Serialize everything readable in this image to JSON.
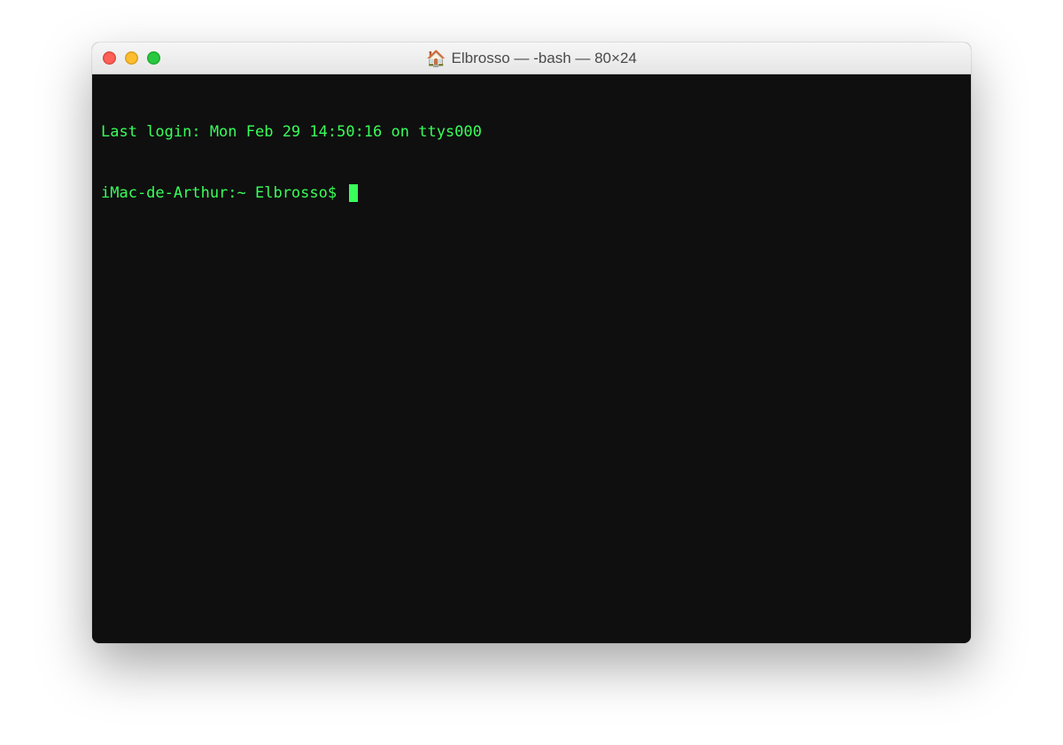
{
  "window": {
    "title_icon": "home-icon",
    "title": "Elbrosso — -bash — 80×24"
  },
  "traffic_lights": {
    "close_color": "#ff5f57",
    "minimize_color": "#ffbd2e",
    "maximize_color": "#28c940"
  },
  "terminal": {
    "text_color": "#39ff5a",
    "background_color": "#0f0f0f",
    "lines": {
      "last_login": "Last login: Mon Feb 29 14:50:16 on ttys000",
      "prompt": "iMac-de-Arthur:~ Elbrosso$ "
    }
  }
}
